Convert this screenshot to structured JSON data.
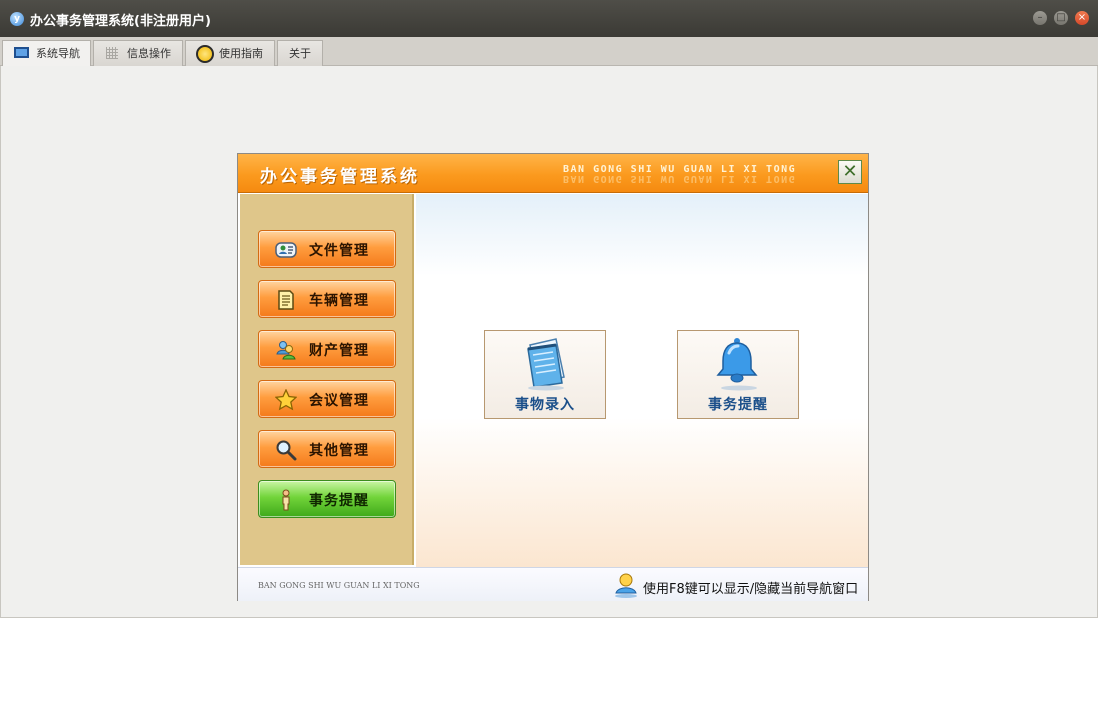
{
  "window": {
    "title": "办公事务管理系统(非注册用户)",
    "app_icon_glyph": "y",
    "buttons": [
      "minimize",
      "maximize",
      "close"
    ]
  },
  "tabs": [
    {
      "label": "系统导航",
      "icon": "monitor-icon",
      "active": true
    },
    {
      "label": "信息操作",
      "icon": "grid-icon",
      "active": false
    },
    {
      "label": "使用指南",
      "icon": "clock-icon",
      "active": false
    },
    {
      "label": "关于",
      "icon": "",
      "active": false
    }
  ],
  "panel": {
    "title": "办公事务管理系统",
    "pinyin": "BAN GONG SHI WU GUAN LI XI TONG",
    "close_glyph": "✕",
    "accent_color": "#fb9a1e"
  },
  "sidebar": {
    "items": [
      {
        "label": "文件管理",
        "icon": "contact-card-icon",
        "style": "orange"
      },
      {
        "label": "车辆管理",
        "icon": "document-icon",
        "style": "orange"
      },
      {
        "label": "财产管理",
        "icon": "users-icon",
        "style": "orange"
      },
      {
        "label": "会议管理",
        "icon": "star-icon",
        "style": "orange"
      },
      {
        "label": "其他管理",
        "icon": "magnifier-icon",
        "style": "orange"
      },
      {
        "label": "事务提醒",
        "icon": "person-icon",
        "style": "green"
      }
    ]
  },
  "tiles": [
    {
      "label": "事物录入",
      "icon": "notepad-icon"
    },
    {
      "label": "事务提醒",
      "icon": "bell-icon"
    }
  ],
  "footer": {
    "pinyin": "BAN GONG SHI WU GUAN LI XI TONG",
    "tip": "使用F8键可以显示/隐藏当前导航窗口",
    "icon": "user-info-icon"
  }
}
